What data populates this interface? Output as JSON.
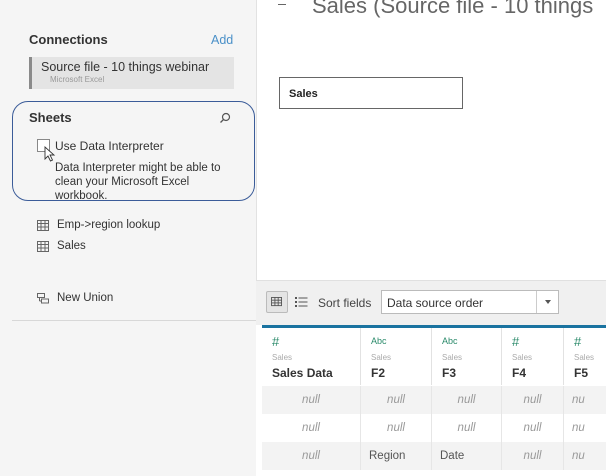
{
  "connections": {
    "title": "Connections",
    "add_label": "Add",
    "item_name": "Source file - 10 things webinar",
    "item_type": "Microsoft Excel"
  },
  "sheets": {
    "title": "Sheets",
    "data_interpreter_label": "Use Data Interpreter",
    "data_interpreter_desc": "Data Interpreter might be able to clean your Microsoft Excel workbook.",
    "items": [
      {
        "label": "Emp->region lookup",
        "icon": "table-icon"
      },
      {
        "label": "Sales",
        "icon": "table-icon"
      }
    ],
    "new_union_label": "New Union"
  },
  "canvas": {
    "title": "Sales (Source file - 10 things",
    "table_label": "Sales"
  },
  "toolbar": {
    "sort_label": "Sort fields",
    "sort_value": "Data source order"
  },
  "grid": {
    "columns": [
      {
        "type": "#",
        "source": "Sales",
        "name": "Sales Data"
      },
      {
        "type": "Abc",
        "source": "Sales",
        "name": "F2"
      },
      {
        "type": "Abc",
        "source": "Sales",
        "name": "F3"
      },
      {
        "type": "#",
        "source": "Sales",
        "name": "F4"
      },
      {
        "type": "#",
        "source": "Sales",
        "name": "F5"
      }
    ],
    "rows": [
      [
        "null",
        "null",
        "null",
        "null",
        "nu"
      ],
      [
        "null",
        "null",
        "null",
        "null",
        "nu"
      ],
      [
        "null",
        "Region",
        "Date",
        "null",
        "nu"
      ]
    ]
  },
  "colors": {
    "accent": "#1a73a0",
    "highlight_outline": "#3b5c99",
    "link": "#4a90c8"
  }
}
